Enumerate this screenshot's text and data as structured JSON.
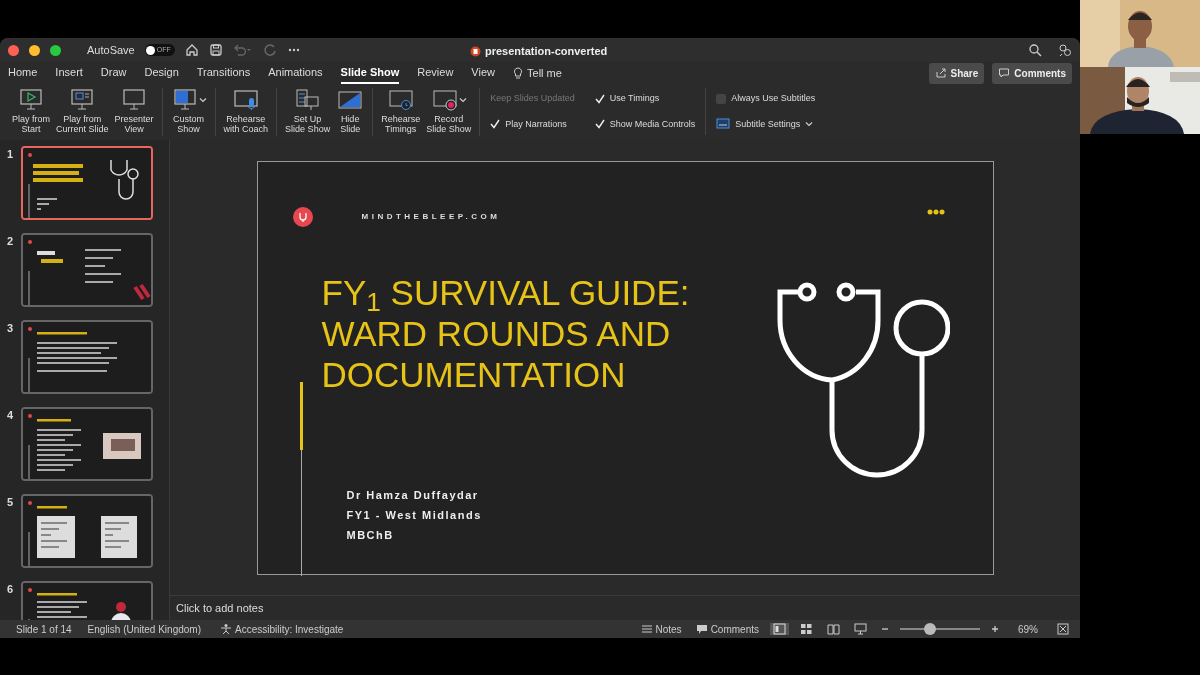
{
  "window": {
    "title": "presentation-converted"
  },
  "autosave": {
    "label": "AutoSave",
    "on": false,
    "state_text": "OFF"
  },
  "menu_tabs": [
    {
      "label": "Home",
      "selected": false
    },
    {
      "label": "Insert",
      "selected": false
    },
    {
      "label": "Draw",
      "selected": false
    },
    {
      "label": "Design",
      "selected": false
    },
    {
      "label": "Transitions",
      "selected": false
    },
    {
      "label": "Animations",
      "selected": false
    },
    {
      "label": "Slide Show",
      "selected": true
    },
    {
      "label": "Review",
      "selected": false
    },
    {
      "label": "View",
      "selected": false
    }
  ],
  "tell_me": "Tell me",
  "header_buttons": [
    {
      "kind": "share",
      "label": "Share"
    },
    {
      "kind": "comments",
      "label": "Comments"
    }
  ],
  "ribbon_groups": [
    [
      {
        "kind": "play-start",
        "lines": [
          "Play from",
          "Start"
        ],
        "dropdown": false
      },
      {
        "kind": "play-current",
        "lines": [
          "Play from",
          "Current Slide"
        ],
        "dropdown": false
      },
      {
        "kind": "presenter",
        "lines": [
          "Presenter",
          "View"
        ],
        "dropdown": false
      }
    ],
    [
      {
        "kind": "custom",
        "lines": [
          "Custom",
          "Show"
        ],
        "dropdown": true
      }
    ],
    [
      {
        "kind": "coach",
        "lines": [
          "Rehearse",
          "with Coach"
        ],
        "dropdown": false
      }
    ],
    [
      {
        "kind": "setup",
        "lines": [
          "Set Up",
          "Slide Show"
        ],
        "dropdown": false
      },
      {
        "kind": "hide",
        "lines": [
          "Hide",
          "Slide"
        ],
        "dropdown": false
      }
    ],
    [
      {
        "kind": "timings",
        "lines": [
          "Rehearse",
          "Timings"
        ],
        "dropdown": false
      },
      {
        "kind": "record",
        "lines": [
          "Record",
          "Slide Show"
        ],
        "dropdown": true
      }
    ]
  ],
  "ribbon_options": [
    [
      {
        "kind": "tick",
        "label": "Keep Slides Updated",
        "checked": false,
        "disabled": true
      },
      {
        "kind": "tick",
        "label": "Play Narrations",
        "checked": true,
        "disabled": false
      }
    ],
    [
      {
        "kind": "tick",
        "label": "Use Timings",
        "checked": true,
        "disabled": false
      },
      {
        "kind": "tick",
        "label": "Show Media Controls",
        "checked": true,
        "disabled": false
      }
    ],
    [
      {
        "kind": "checkbox",
        "label": "Always Use Subtitles",
        "checked": false
      },
      {
        "kind": "menu",
        "label": "Subtitle Settings"
      }
    ]
  ],
  "thumbnails": [
    {
      "number": "1",
      "kind": "title",
      "selected": true
    },
    {
      "number": "2",
      "kind": "contents",
      "selected": false
    },
    {
      "number": "3",
      "kind": "bullets",
      "selected": false
    },
    {
      "number": "4",
      "kind": "bullets-photo",
      "selected": false
    },
    {
      "number": "5",
      "kind": "documents",
      "selected": false
    },
    {
      "number": "6",
      "kind": "bullets-figure",
      "selected": false
    }
  ],
  "slide": {
    "site": "MINDTHEBLEEP.COM",
    "title_lines": [
      "FY$_{1}$ SURVIVAL GUIDE:",
      "WARD ROUNDS AND",
      "DOCUMENTATION"
    ],
    "presenter_lines": [
      "Dr Hamza Duffaydar",
      "FY1 - West Midlands",
      "MBChB"
    ]
  },
  "notes_placeholder": "Click to add notes",
  "status_bar": {
    "slide": "Slide 1 of 14",
    "language": "English (United Kingdom)",
    "accessibility": "Accessibility: Investigate",
    "notes": "Notes",
    "comments": "Comments",
    "views": [
      {
        "kind": "normal",
        "selected": true
      },
      {
        "kind": "sorter",
        "selected": false
      },
      {
        "kind": "reading",
        "selected": false
      },
      {
        "kind": "slideshow",
        "selected": false
      }
    ],
    "zoom": {
      "level": 0.38,
      "text": "69%"
    }
  },
  "video_tiles": [
    {
      "kind": "picture"
    },
    {
      "kind": "picture"
    }
  ]
}
